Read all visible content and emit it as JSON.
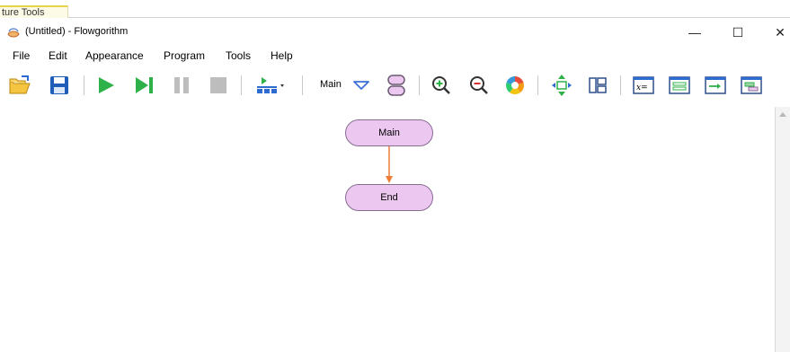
{
  "window": {
    "picture_tab": "ture Tools",
    "title": "(Untitled) - Flowgorithm",
    "controls": {
      "minimize": "—",
      "maximize": "☐",
      "close": "✕"
    }
  },
  "menu": [
    "File",
    "Edit",
    "Appearance",
    "Program",
    "Tools",
    "Help"
  ],
  "toolbar": {
    "function_select": "Main",
    "icons": [
      "open-folder-icon",
      "save-icon",
      "run-icon",
      "step-icon",
      "pause-icon",
      "stop-icon",
      "layout-icon",
      "function-select-chevron-icon",
      "functions-icon",
      "zoom-in-icon",
      "zoom-out-icon",
      "color-wheel-icon",
      "resize-icon",
      "panels-icon",
      "variable-watch-icon",
      "source-code-icon",
      "console-icon",
      "layout-windows-icon"
    ]
  },
  "flowchart": {
    "nodes": [
      {
        "label": "Main",
        "type": "start"
      },
      {
        "label": "End",
        "type": "end"
      }
    ],
    "colors": {
      "terminal_fill": "#ecc8f0",
      "terminal_border": "#8a6c93",
      "arrow": "#ee7c34"
    }
  }
}
